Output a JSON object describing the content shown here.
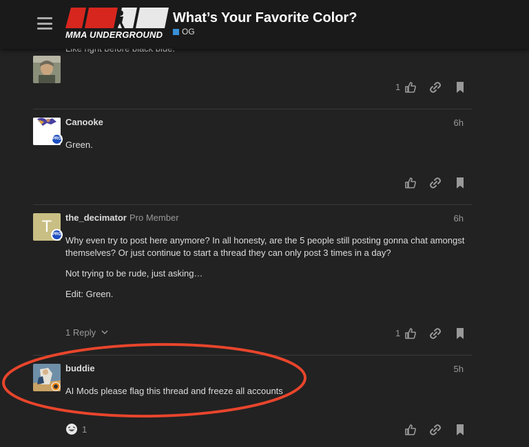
{
  "header": {
    "logo_text": "MMA UNDERGROUND",
    "topic_title": "What’s Your Favorite Color?",
    "category": "OG",
    "category_color": "#3a8fd6"
  },
  "posts": [
    {
      "partial_text": "Like right before black blue.",
      "like_count": "1"
    },
    {
      "username": "Canooke",
      "time": "6h",
      "badge": "PRO",
      "body": [
        "Green."
      ]
    },
    {
      "username": "the_decimator",
      "user_title": "Pro Member",
      "avatar_letter": "T",
      "badge": "PRO",
      "time": "6h",
      "body": [
        "Why even try to post here anymore? In all honesty, are the 5 people still posting gonna chat amongst themselves? Or just continue to start a thread they can only post 3 times in a day?",
        "Not trying to be rude, just asking…",
        "Edit: Green."
      ],
      "replies_label": "1 Reply",
      "like_count": "1"
    },
    {
      "username": "buddie",
      "time": "5h",
      "body": [
        "AI Mods please flag this thread and freeze all accounts"
      ],
      "reaction_count": "1"
    }
  ],
  "colors": {
    "background": "#222222",
    "header": "#1a1a1a",
    "annotation": "#e8452c",
    "logo_red": "#d7261e"
  },
  "icons": [
    "menu-icon",
    "like-icon",
    "link-icon",
    "bookmark-icon",
    "chevron-down-icon",
    "laughing-emoji-icon"
  ]
}
